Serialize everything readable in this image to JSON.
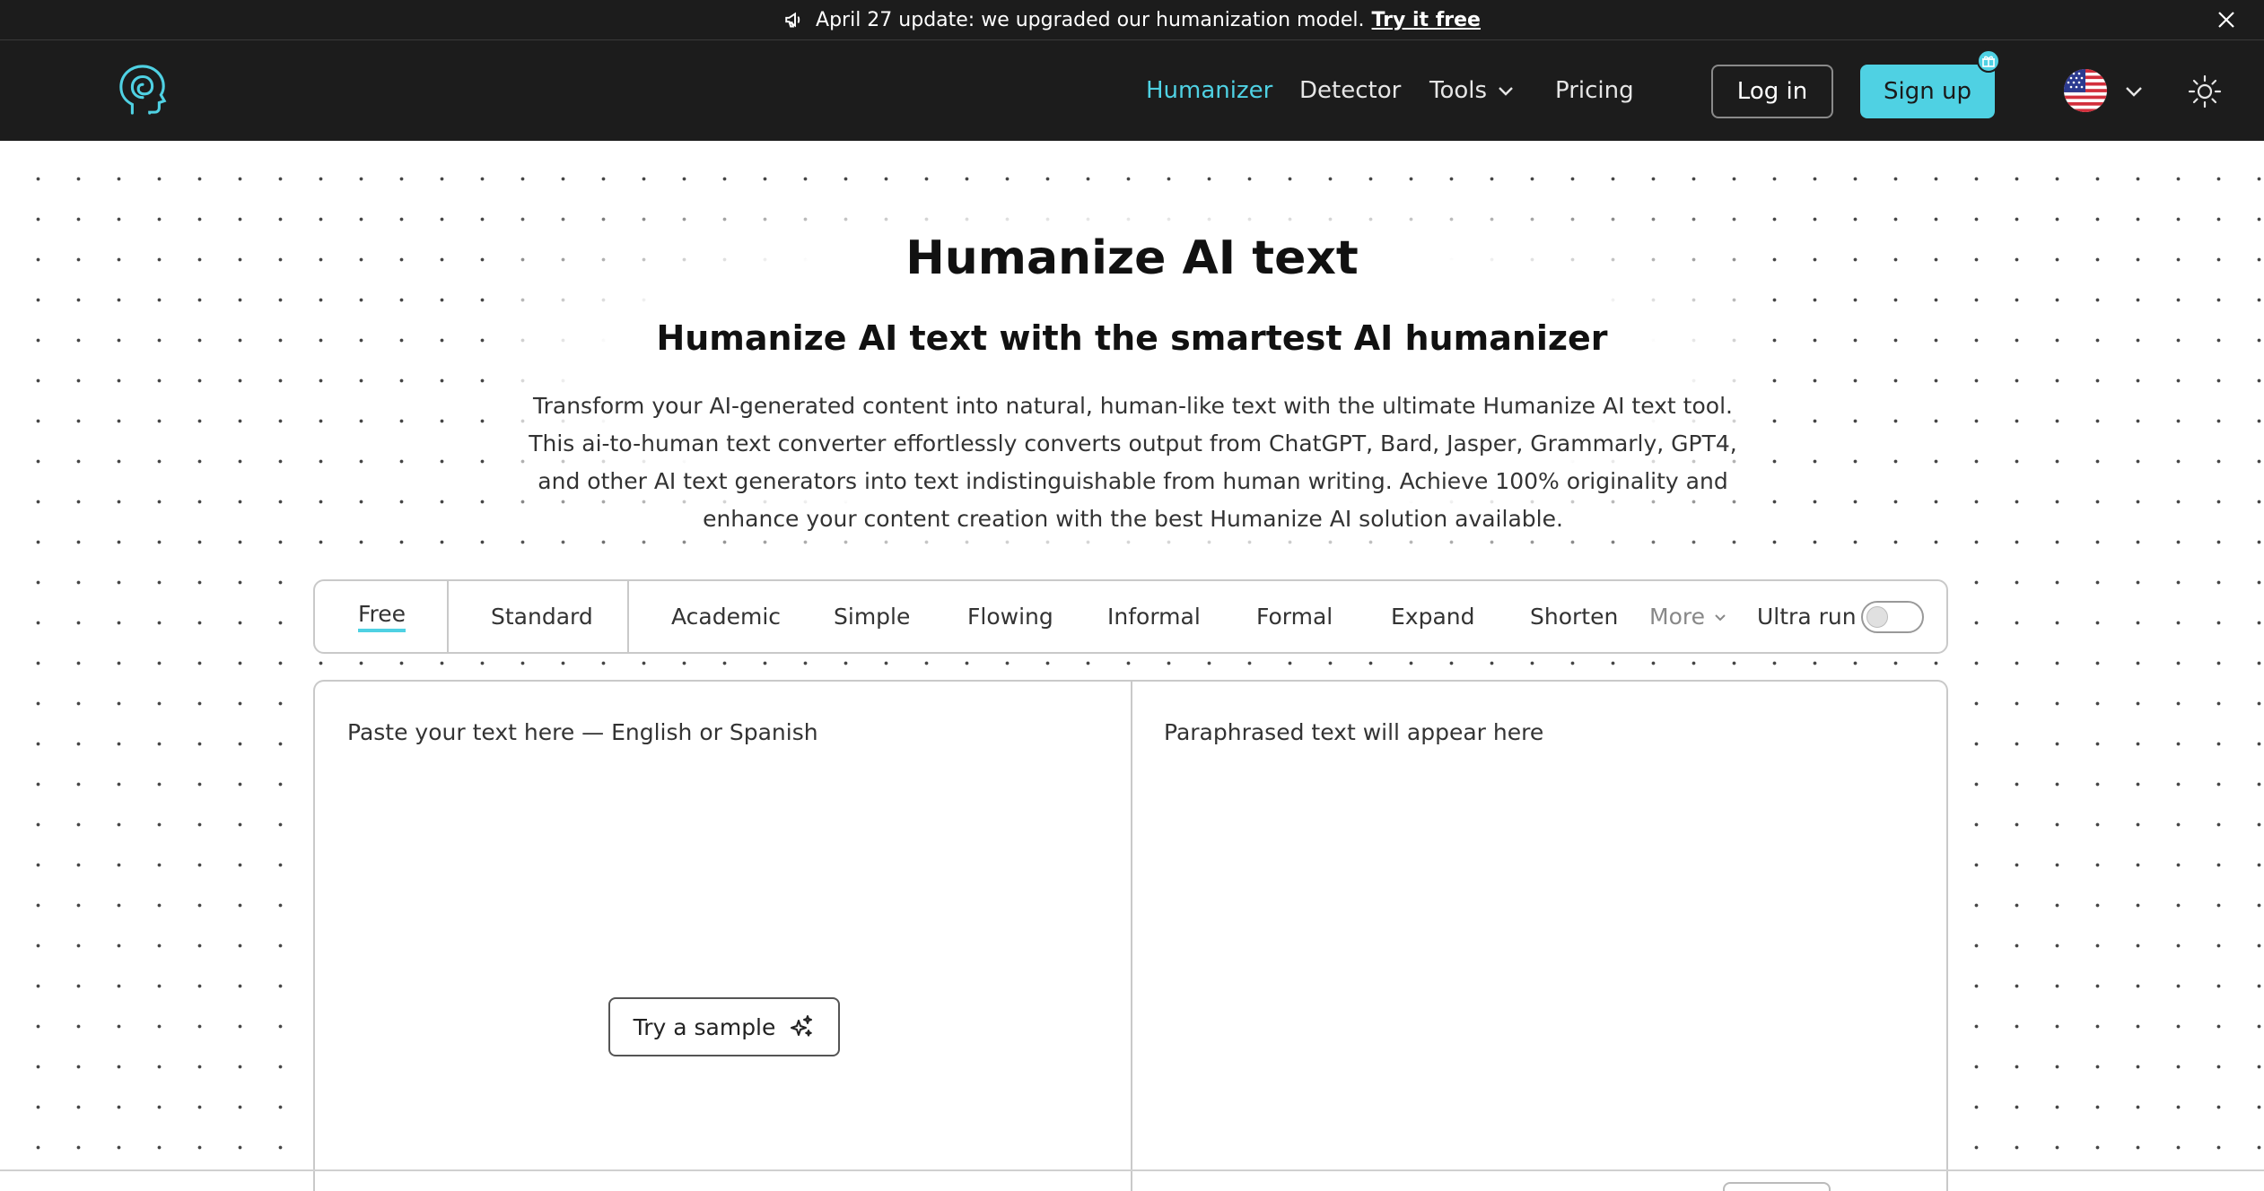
{
  "announcement": {
    "text": "April 27 update: we upgraded our humanization model.",
    "link": "Try it free"
  },
  "nav": {
    "items": [
      {
        "label": "Humanizer",
        "active": true
      },
      {
        "label": "Detector"
      },
      {
        "label": "Tools"
      },
      {
        "label": "Pricing"
      }
    ],
    "login": "Log in",
    "signup": "Sign up"
  },
  "hero": {
    "title": "Humanize AI text",
    "subtitle": "Humanize AI text with the smartest AI humanizer",
    "description": "Transform your AI-generated content into natural, human-like text with the ultimate Humanize AI text tool. This ai-to-human text converter effortlessly converts output from ChatGPT, Bard, Jasper, Grammarly, GPT4, and other AI text generators into text indistinguishable from human writing. Achieve 100% originality and enhance your content creation with the best Humanize AI solution available."
  },
  "modes": {
    "items": [
      "Free",
      "Standard",
      "Academic",
      "Simple",
      "Flowing",
      "Informal",
      "Formal",
      "Expand",
      "Shorten"
    ],
    "more": "More",
    "ultra_label": "Ultra run"
  },
  "editor": {
    "input_placeholder": "Paste your text here — English or Spanish",
    "output_placeholder": "Paraphrased text will appear here",
    "sample_button": "Try a sample"
  },
  "colors": {
    "accent": "#4fd1e3",
    "dark": "#1c1c1c"
  }
}
